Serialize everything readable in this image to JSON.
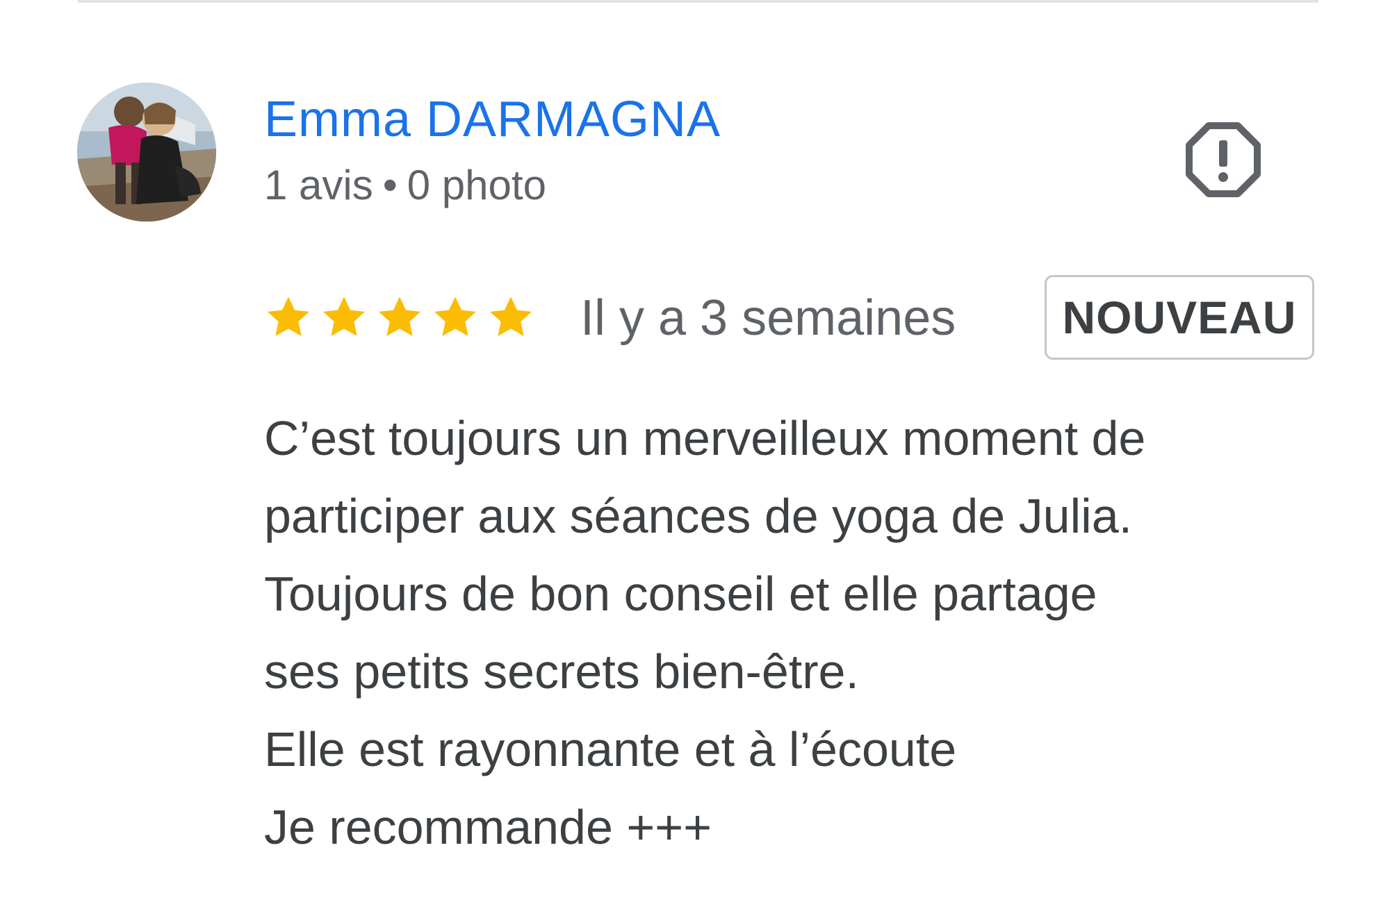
{
  "review": {
    "reviewer": {
      "name": "Emma DARMAGNA",
      "reviews_count_label": "1 avis",
      "separator": "•",
      "photos_count_label": "0 photo"
    },
    "rating": {
      "stars": 5,
      "max_stars": 5,
      "star_color": "#fbbc04"
    },
    "date": "Il y a 3 semaines",
    "badge": "NOUVEAU",
    "text_lines": [
      "C’est toujours un merveilleux moment de",
      "participer aux séances de yoga de Julia.",
      "Toujours de bon conseil et elle partage",
      "ses petits secrets bien-être.",
      "Elle est rayonnante et à l’écoute",
      "Je recommande +++"
    ]
  },
  "icons": {
    "report": "report-octagon-icon",
    "star": "star-icon"
  },
  "colors": {
    "name": "#1a73e8",
    "meta": "#5f6368",
    "body": "#3c4043",
    "star": "#fbbc04"
  }
}
